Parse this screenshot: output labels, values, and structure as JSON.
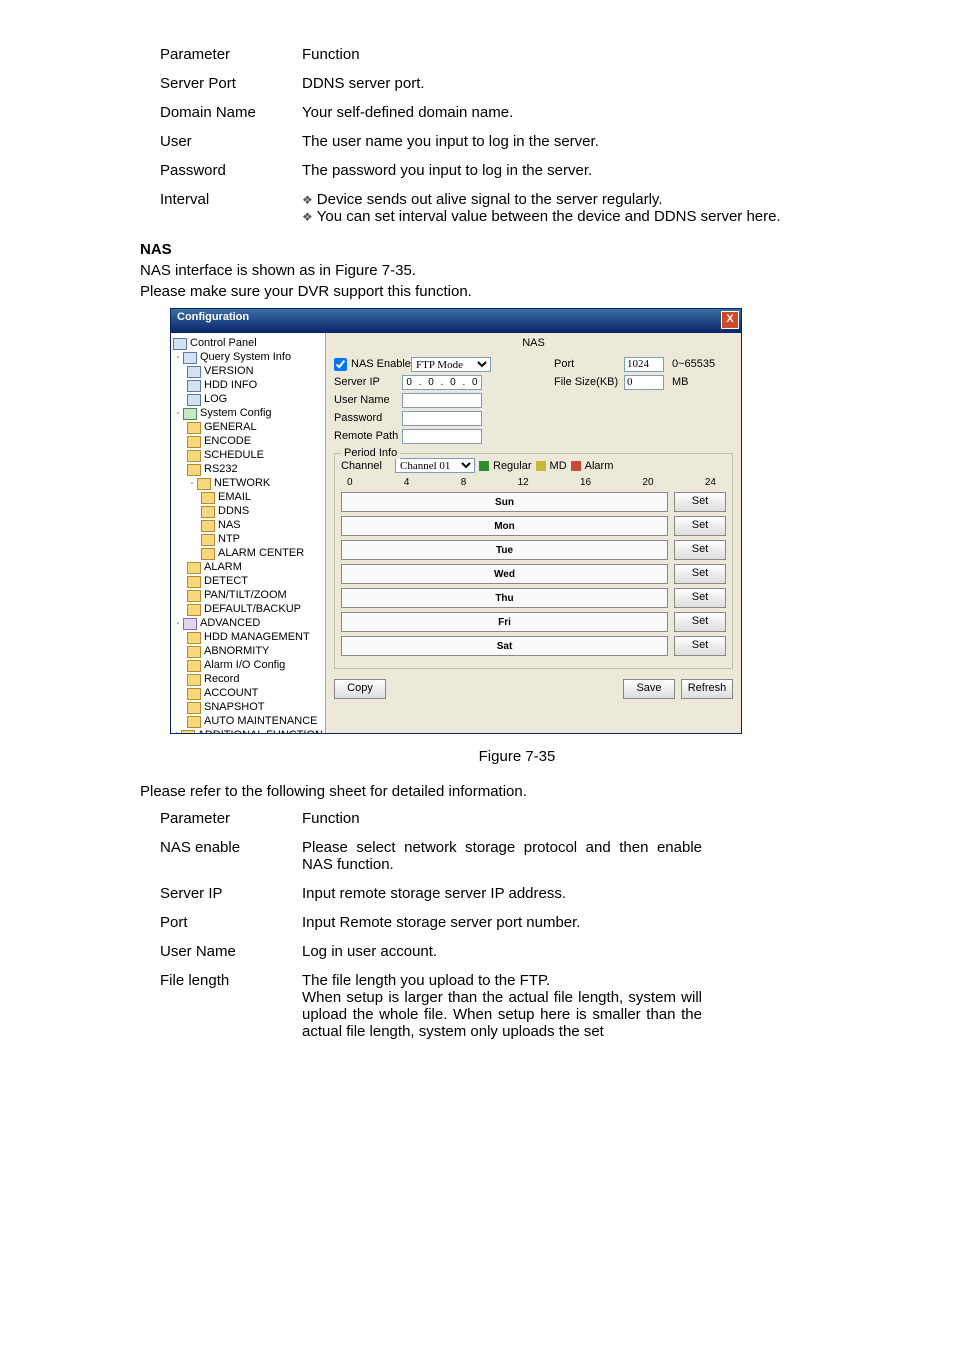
{
  "table1": {
    "header": {
      "param": "Parameter",
      "func": "Function"
    },
    "rows": [
      {
        "param": "Server Port",
        "func": "DDNS server port."
      },
      {
        "param": "Domain Name",
        "func": "Your self-defined domain name."
      },
      {
        "param": "User",
        "func": "The user name you input to log in the server."
      },
      {
        "param": "Password",
        "func": "The password you input to log in the server."
      },
      {
        "param": "Interval",
        "func_a": "Device sends out alive signal to the server regularly.",
        "func_b": "You can set interval value between the device and DDNS server here."
      }
    ]
  },
  "nas_heading": "NAS",
  "nas_intro1": "NAS interface is shown as in Figure 7-35.",
  "nas_intro2": "Please make sure your DVR support this function.",
  "figref": "Figure 7-35",
  "post_fig_intro": "Please refer to the following sheet for detailed information.",
  "table2": {
    "header": {
      "param": "Parameter",
      "func": "Function"
    },
    "rows": [
      {
        "param": "NAS enable",
        "func": "Please select network storage protocol and then enable NAS function."
      },
      {
        "param": "Server IP",
        "func": "Input remote storage server IP address."
      },
      {
        "param": "Port",
        "func": "Input Remote storage server port number."
      },
      {
        "param": "User Name",
        "func": "Log in user account."
      },
      {
        "param": "File length",
        "func": "The file length you upload to the FTP.",
        "func2": "When setup is larger than the actual file length, system will upload the whole file. When setup here is smaller than the actual file length, system only uploads the set"
      }
    ]
  },
  "win": {
    "title": "Configuration",
    "close": "X",
    "tree": {
      "root": "Control Panel",
      "query": "Query System Info",
      "version": "VERSION",
      "hddinfo": "HDD INFO",
      "log": "LOG",
      "sysconfig": "System Config",
      "general": "GENERAL",
      "encode": "ENCODE",
      "schedule": "SCHEDULE",
      "rs232": "RS232",
      "network": "NETWORK",
      "email": "EMAIL",
      "ddns": "DDNS",
      "nas": "NAS",
      "ntp": "NTP",
      "alarmcenter": "ALARM CENTER",
      "alarm": "ALARM",
      "detect": "DETECT",
      "ptz": "PAN/TILT/ZOOM",
      "defbkp": "DEFAULT/BACKUP",
      "advanced": "ADVANCED",
      "hddmgmt": "HDD MANAGEMENT",
      "abnorm": "ABNORMITY",
      "alarmio": "Alarm I/O Config",
      "record": "Record",
      "account": "ACCOUNT",
      "snapshot": "SNAPSHOT",
      "automaint": "AUTO MAINTENANCE",
      "addfunc": "ADDITIONAL FUNCTION"
    },
    "panel": {
      "title": "NAS",
      "nasenable_label": "NAS Enable",
      "ftpmode": "FTP Mode",
      "serverip_label": "Server IP",
      "ip1": "0",
      "ip2": "0",
      "ip3": "0",
      "ip4": "0",
      "username_label": "User Name",
      "password_label": "Password",
      "remotepath_label": "Remote Path",
      "port_label": "Port",
      "port_value": "1024",
      "port_range": "0~65535",
      "filesize_label": "File Size(KB)",
      "filesize_value": "0",
      "filesize_unit": "MB",
      "period_legend": "Period Info",
      "channel_label": "Channel",
      "channel_value": "Channel 01",
      "legend_regular": "Regular",
      "legend_md": "MD",
      "legend_alarm": "Alarm",
      "hours": [
        "0",
        "4",
        "8",
        "12",
        "16",
        "20",
        "24"
      ],
      "days": [
        "Sun",
        "Mon",
        "Tue",
        "Wed",
        "Thu",
        "Fri",
        "Sat"
      ],
      "set_btn": "Set",
      "copy_btn": "Copy",
      "save_btn": "Save",
      "refresh_btn": "Refresh"
    }
  }
}
